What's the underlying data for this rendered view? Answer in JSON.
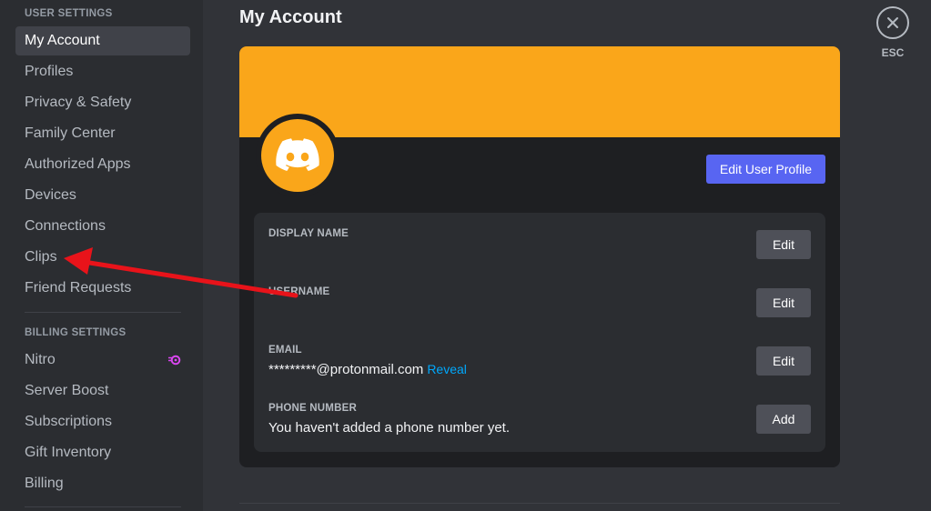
{
  "sidebar": {
    "user_settings_header": "USER SETTINGS",
    "user_items": [
      {
        "label": "My Account"
      },
      {
        "label": "Profiles"
      },
      {
        "label": "Privacy & Safety"
      },
      {
        "label": "Family Center"
      },
      {
        "label": "Authorized Apps"
      },
      {
        "label": "Devices"
      },
      {
        "label": "Connections"
      },
      {
        "label": "Clips"
      },
      {
        "label": "Friend Requests"
      }
    ],
    "billing_settings_header": "BILLING SETTINGS",
    "billing_items": [
      {
        "label": "Nitro",
        "icon": "nitro-icon"
      },
      {
        "label": "Server Boost"
      },
      {
        "label": "Subscriptions"
      },
      {
        "label": "Gift Inventory"
      },
      {
        "label": "Billing"
      }
    ]
  },
  "main": {
    "title": "My Account",
    "close_label": "ESC",
    "edit_profile_label": "Edit User Profile",
    "fields": [
      {
        "label": "DISPLAY NAME",
        "value": "",
        "button": "Edit"
      },
      {
        "label": "USERNAME",
        "value": "",
        "button": "Edit"
      },
      {
        "label": "EMAIL",
        "value": "*********@protonmail.com",
        "link": "Reveal",
        "button": "Edit"
      },
      {
        "label": "PHONE NUMBER",
        "value": "You haven't added a phone number yet.",
        "button": "Add"
      }
    ]
  },
  "colors": {
    "banner": "#faa61a",
    "avatar": "#faa61a",
    "blurple": "#5865f2",
    "annotation_arrow": "#e8131a"
  }
}
